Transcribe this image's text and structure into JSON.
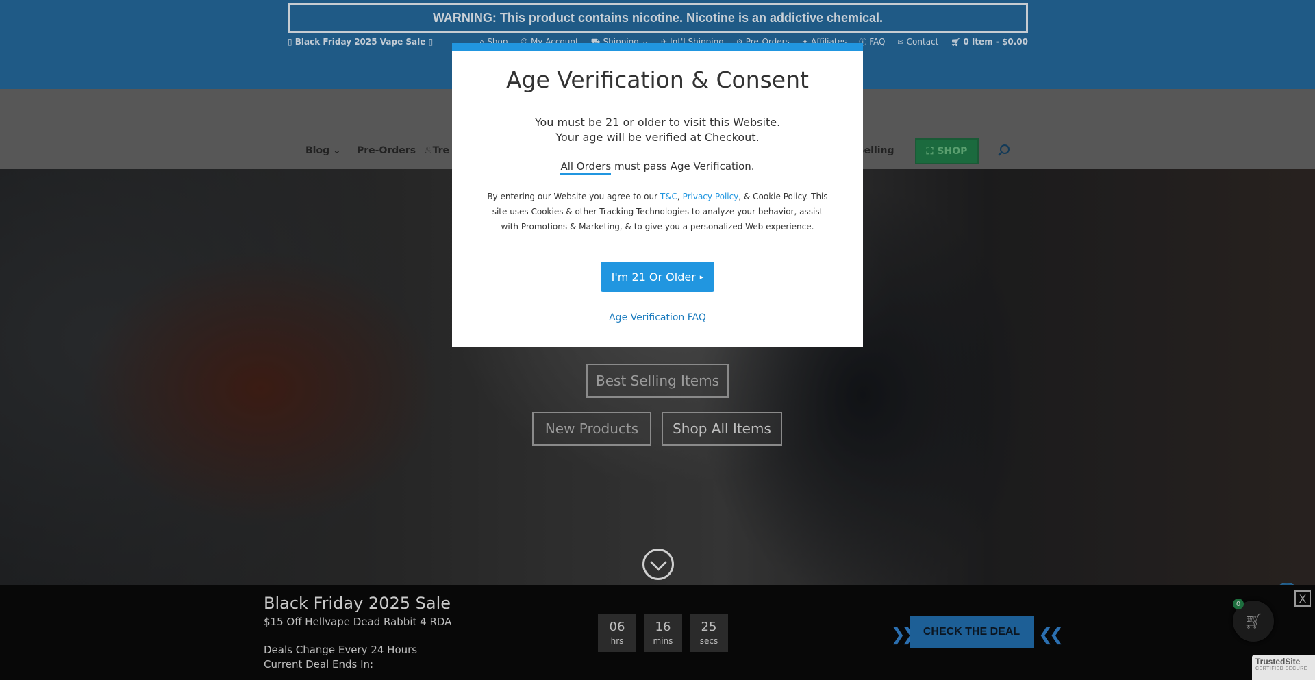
{
  "header": {
    "warning": "WARNING: This product contains nicotine. Nicotine is an addictive chemical.",
    "promo": "Black Friday 2025 Vape Sale",
    "links": {
      "shop": "Shop",
      "account": "My Account",
      "shipping": "Shipping",
      "intl": "Int'l Shipping",
      "preorders": "Pre-Orders",
      "affiliates": "Affiliates",
      "faq": "FAQ",
      "contact": "Contact"
    },
    "cart": "0 Item - $0.00"
  },
  "nav": {
    "blog": "Blog",
    "preorders": "Pre-Orders",
    "trending": "Tre",
    "best_selling": "t Selling",
    "shop_button": "SHOP"
  },
  "hero": {
    "best_selling": "Best Selling Items",
    "new_products": "New Products",
    "shop_all": "Shop All Items",
    "side_button": "+"
  },
  "modal": {
    "title": "Age Verification & Consent",
    "line1": "You must be 21 or older to visit this Website.",
    "line2": "Your age will be verified at Checkout.",
    "orders_link": "All Orders",
    "orders_rest": " must pass Age Verification.",
    "consent_start": "By entering our Website you agree to our ",
    "tc_link": "T&C",
    "comma": ", ",
    "privacy_link": "Privacy Policy",
    "consent_end": ", & Cookie Policy. This site uses Cookies & other Tracking Technologies to analyze your behavior, assist with Promotions & Marketing, & to give you a personalized Web experience.",
    "confirm_button": "I'm 21 Or Older",
    "faq_link": "Age Verification FAQ"
  },
  "deal": {
    "title": "Black Friday 2025 Sale",
    "subtitle": "$15 Off Hellvape Dead Rabbit 4 RDA",
    "note1": "Deals Change Every 24 Hours",
    "note2": "Current Deal Ends In:",
    "countdown": [
      {
        "value": "06",
        "unit": "hrs"
      },
      {
        "value": "16",
        "unit": "mins"
      },
      {
        "value": "25",
        "unit": "secs"
      }
    ],
    "button": "CHECK THE DEAL",
    "cart_count": "0",
    "close": "X"
  },
  "trusted": {
    "name": "TrustedSite",
    "tag": "CERTIFIED SECURE"
  },
  "colors": {
    "header_blue": "#1f5a86",
    "accent_blue": "#2196e0",
    "shop_green": "#1b6a3e",
    "deal_bar": "#080808"
  }
}
